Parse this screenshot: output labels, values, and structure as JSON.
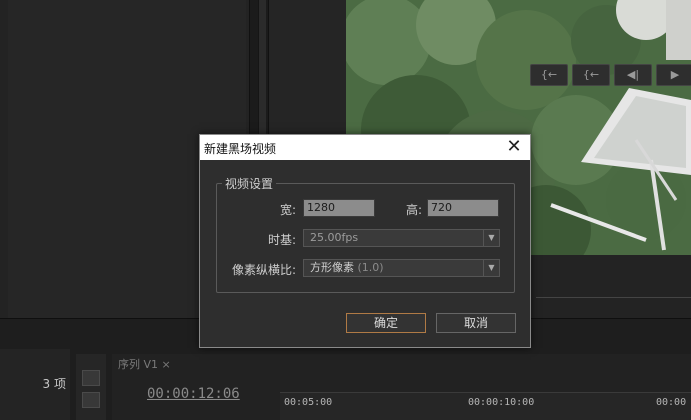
{
  "dialog": {
    "title": "新建黑场视频",
    "close_glyph": "✕",
    "group_title": "视频设置",
    "width_label": "宽:",
    "width_value": "1280",
    "height_label": "高:",
    "height_value": "720",
    "timebase_label": "时基:",
    "timebase_value": "25.00fps",
    "par_label": "像素纵横比:",
    "par_value": "方形像素",
    "par_value_suffix": "(1.0)",
    "ok_label": "确定",
    "cancel_label": "取消"
  },
  "project": {
    "item_count": "3 项"
  },
  "sequence": {
    "tab_label": "序列 V1",
    "tab_close": "×",
    "timecode": "00:00:12:06",
    "ruler_labels": [
      "00:05:00",
      "00:00:10:00",
      "00:00"
    ]
  },
  "transport": {
    "step_back_glyph": "{←",
    "prev_frame_glyph": "◀|",
    "play_glyph": "▶"
  },
  "colors": {
    "accent_border": "#b07a45",
    "dialog_bg": "#2e2e2e",
    "titlebar_bg": "#ffffff"
  }
}
